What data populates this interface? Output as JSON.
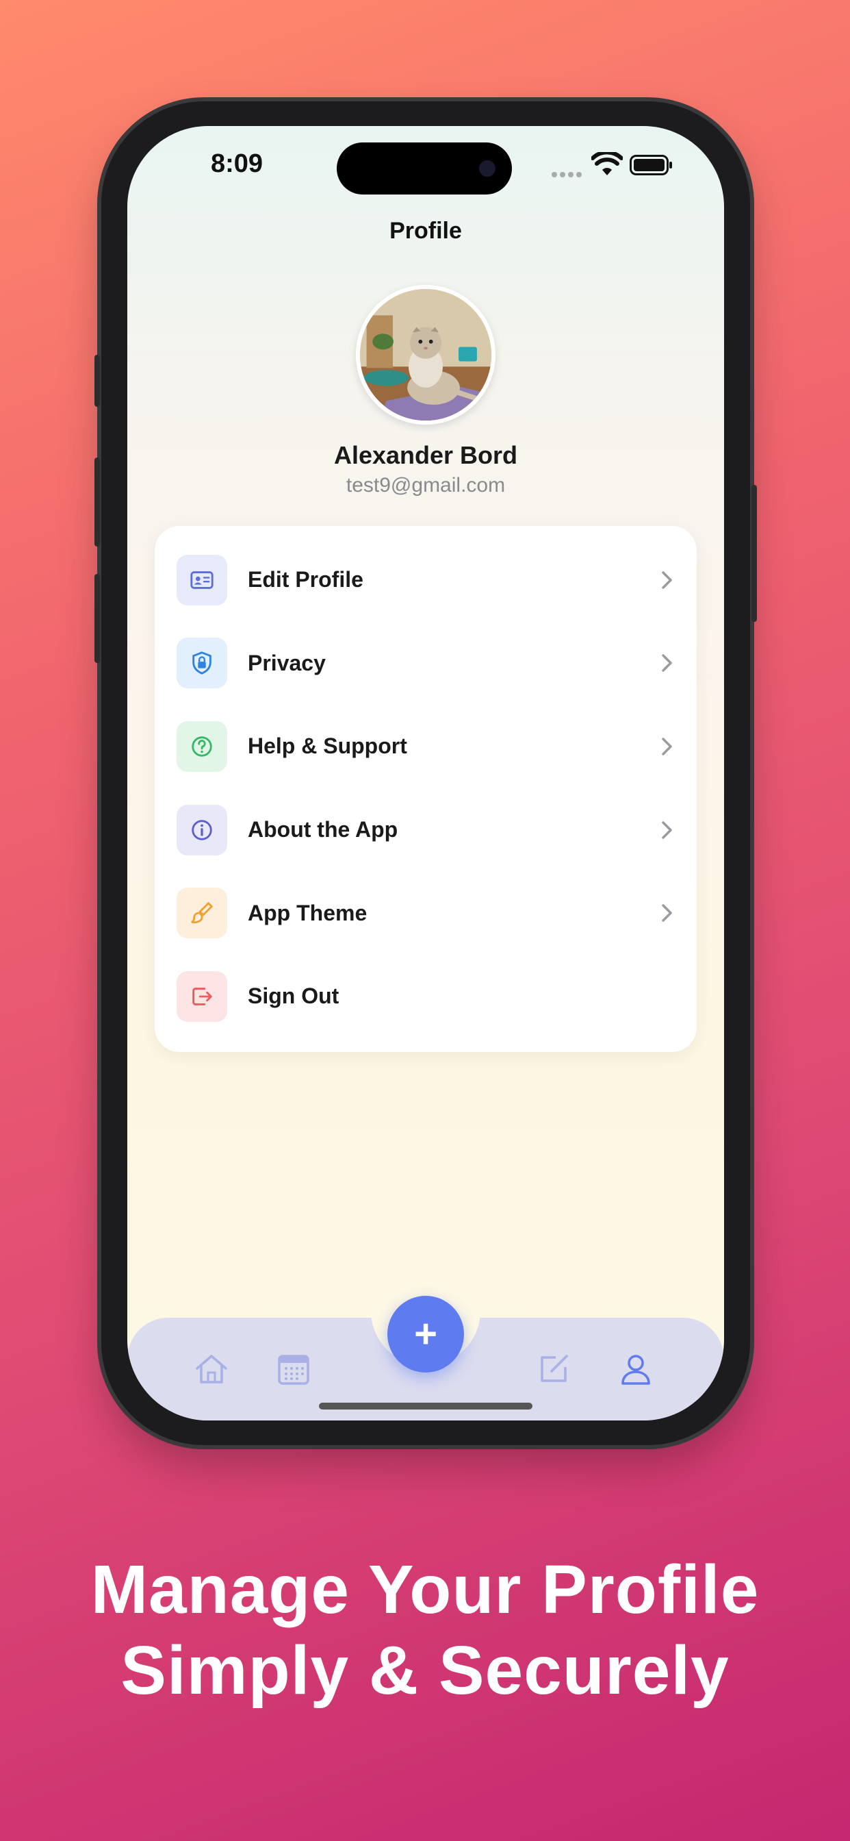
{
  "status_bar": {
    "time": "8:09"
  },
  "header": {
    "title": "Profile"
  },
  "profile": {
    "name": "Alexander Bord",
    "email": "test9@gmail.com"
  },
  "menu": {
    "items": [
      {
        "label": "Edit Profile",
        "icon": "id-card-icon",
        "color": "#5b6fd6",
        "bg": "#e7eafb",
        "chevron": true
      },
      {
        "label": "Privacy",
        "icon": "shield-lock-icon",
        "color": "#2f82e0",
        "bg": "#e2effc",
        "chevron": true
      },
      {
        "label": "Help & Support",
        "icon": "question-circle-icon",
        "color": "#34b868",
        "bg": "#e2f6e8",
        "chevron": true
      },
      {
        "label": "About the App",
        "icon": "info-circle-icon",
        "color": "#5b5fc7",
        "bg": "#e8e8f8",
        "chevron": true
      },
      {
        "label": "App Theme",
        "icon": "paintbrush-icon",
        "color": "#f0a030",
        "bg": "#fdefdc",
        "chevron": true
      },
      {
        "label": "Sign Out",
        "icon": "sign-out-icon",
        "color": "#ee5a5a",
        "bg": "#fde4e4",
        "chevron": false
      }
    ]
  },
  "tabbar": {
    "fab_label": "+",
    "tabs": [
      {
        "icon": "home-icon"
      },
      {
        "icon": "calendar-icon"
      },
      {
        "icon": "edit-icon"
      },
      {
        "icon": "profile-icon"
      }
    ],
    "active_color": "#5e7cf0",
    "inactive_color": "#a8b0e6"
  },
  "caption": {
    "line1": "Manage Your Profile",
    "line2": "Simply & Securely"
  }
}
